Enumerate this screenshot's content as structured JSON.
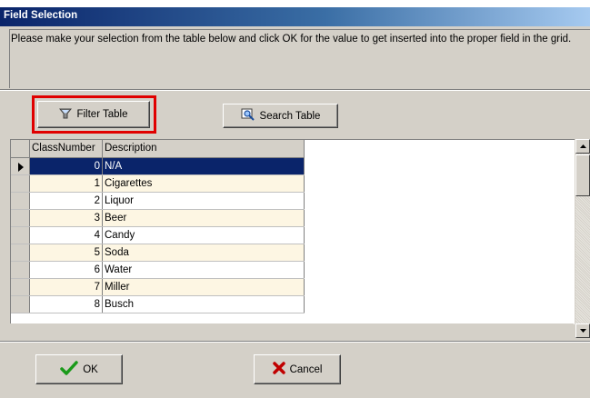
{
  "window": {
    "title": "Field Selection"
  },
  "instructions": "Please make your selection from the table below and click OK for the value to get inserted into the proper field in the grid.",
  "toolbar": {
    "filter_label": "Filter Table",
    "search_label": "Search Table"
  },
  "grid": {
    "columns": [
      "ClassNumber",
      "Description"
    ],
    "rows": [
      {
        "class_number": "0",
        "description": "N/A"
      },
      {
        "class_number": "1",
        "description": "Cigarettes"
      },
      {
        "class_number": "2",
        "description": "Liquor"
      },
      {
        "class_number": "3",
        "description": "Beer"
      },
      {
        "class_number": "4",
        "description": "Candy"
      },
      {
        "class_number": "5",
        "description": "Soda"
      },
      {
        "class_number": "6",
        "description": "Water"
      },
      {
        "class_number": "7",
        "description": "Miller"
      },
      {
        "class_number": "8",
        "description": "Busch"
      }
    ],
    "selected_row": 0
  },
  "footer": {
    "ok_label": "OK",
    "cancel_label": "Cancel"
  },
  "colors": {
    "highlight": "#e00000",
    "selection": "#0a246a",
    "title_bar": "#0a246a"
  }
}
